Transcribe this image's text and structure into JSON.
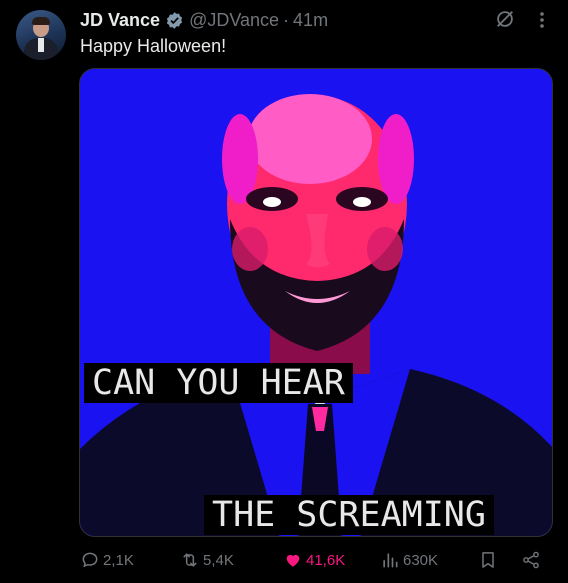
{
  "post": {
    "author_name": "JD Vance",
    "handle": "@JDVance",
    "separator": "·",
    "time_ago": "41m",
    "text": "Happy Halloween!",
    "image": {
      "caption_top": "CAN YOU HEAR",
      "caption_bottom": "THE SCREAMING"
    },
    "metrics": {
      "replies": "2,1K",
      "reposts": "5,4K",
      "likes": "41,6K",
      "views": "630K"
    }
  },
  "icons": {
    "verified": "verified-badge-icon",
    "grok": "grok-icon",
    "more": "more-options-icon",
    "reply": "reply-icon",
    "repost": "repost-icon",
    "like": "heart-icon",
    "views": "views-chart-icon",
    "bookmark": "bookmark-icon",
    "share": "share-icon"
  },
  "colors": {
    "background": "#000000",
    "text_primary": "#e7e9ea",
    "text_secondary": "#71767b",
    "like_pink": "#f91880",
    "image_blue": "#1a12f0",
    "image_magenta": "#f01ec8"
  }
}
